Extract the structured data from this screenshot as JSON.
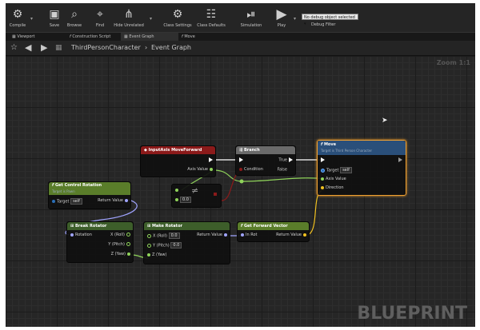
{
  "toolbar": {
    "buttons": [
      {
        "label": "Compile",
        "icon": "compile-icon"
      },
      {
        "label": "Save",
        "icon": "save-icon"
      },
      {
        "label": "Browse",
        "icon": "browse-icon"
      },
      {
        "label": "Find",
        "icon": "find-icon"
      },
      {
        "label": "Hide Unrelated",
        "icon": "hide-unrelated-icon"
      },
      {
        "label": "Class Settings",
        "icon": "gear-icon"
      },
      {
        "label": "Class Defaults",
        "icon": "class-defaults-icon"
      },
      {
        "label": "Simulation",
        "icon": "simulation-icon"
      },
      {
        "label": "Play",
        "icon": "play-icon"
      }
    ],
    "debug_selected": "No debug object selected ▾",
    "debug_label": "Debug Filter"
  },
  "tabs": [
    {
      "label": "Viewport"
    },
    {
      "label": "Construction Script"
    },
    {
      "label": "Event Graph"
    },
    {
      "label": "Move"
    }
  ],
  "breadcrumb": {
    "root": "ThirdPersonCharacter",
    "separator": "›",
    "current": "Event Graph"
  },
  "zoom": "Zoom 1:1",
  "watermark": "BLUEPRINT",
  "colors": {
    "event": "#8b1a1a",
    "function": "#5a7d2a",
    "pure": "#3d5e2a",
    "macro": "#6a6a6a",
    "call": "#2a4f7a",
    "accent": "#f0a030"
  },
  "nodes": {
    "input_axis": {
      "title": "InputAxis MoveForward",
      "axis_value": "Axis Value"
    },
    "branch": {
      "title": "Branch",
      "condition": "Condition",
      "true": "True",
      "false": "False"
    },
    "move": {
      "title": "Move",
      "subtitle": "Target is Third Person Character",
      "target": "Target",
      "target_value": "self",
      "axis_value": "Axis Value",
      "direction": "Direction"
    },
    "compare": {
      "value": "0.0"
    },
    "get_control_rotation": {
      "title": "Get Control Rotation",
      "subtitle": "Target is Pawn",
      "target": "Target",
      "target_value": "self",
      "return": "Return Value"
    },
    "break_rotator": {
      "title": "Break Rotator",
      "rotation": "Rotation",
      "x": "X (Roll)",
      "y": "Y (Pitch)",
      "z": "Z (Yaw)"
    },
    "make_rotator": {
      "title": "Make Rotator",
      "x": "X (Roll)",
      "x_value": "0.0",
      "y": "Y (Pitch)",
      "y_value": "0.0",
      "z": "Z (Yaw)",
      "return": "Return Value"
    },
    "get_forward_vector": {
      "title": "Get Forward Vector",
      "in_rot": "In Rot",
      "return": "Return Value"
    }
  }
}
